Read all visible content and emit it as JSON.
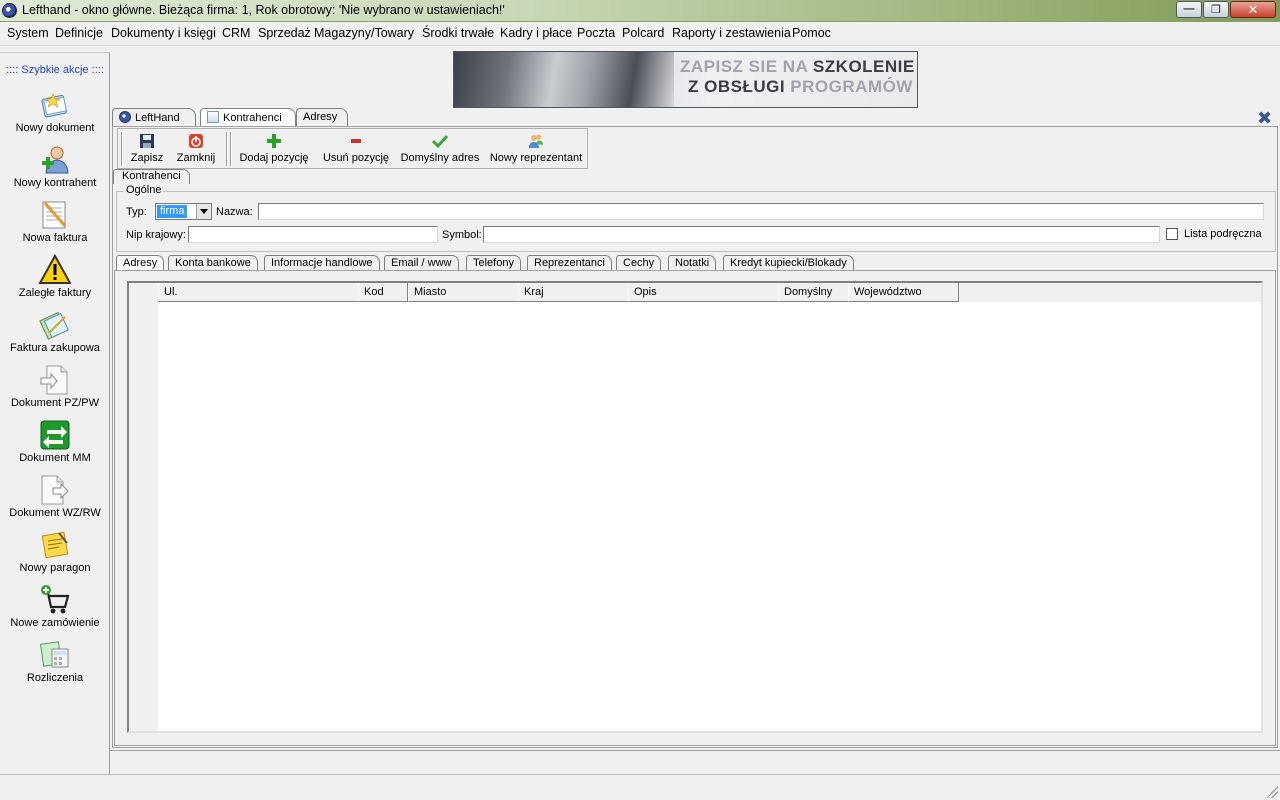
{
  "window": {
    "title": "Lefthand - okno główne. Bieżąca firma: 1, Rok obrotowy: 'Nie wybrano w ustawieniach!'"
  },
  "menu": [
    "System",
    "Definicje",
    "Dokumenty i księgi",
    "CRM",
    "Sprzedaż",
    "Magazyny/Towary",
    "Środki trwałe",
    "Kadry i płace",
    "Poczta",
    "Polcard",
    "Raporty i zestawienia",
    "Pomoc"
  ],
  "sidebar": {
    "title": ":::: Szybkie akcje ::::",
    "items": [
      {
        "label": "Nowy dokument",
        "icon": "new-document-icon"
      },
      {
        "label": "Nowy kontrahent",
        "icon": "new-contractor-icon"
      },
      {
        "label": "Nowa faktura",
        "icon": "new-invoice-icon"
      },
      {
        "label": "Zaległe faktury",
        "icon": "warning-icon"
      },
      {
        "label": "Faktura zakupowa",
        "icon": "purchase-invoice-icon"
      },
      {
        "label": "Dokument PZ/PW",
        "icon": "document-in-icon"
      },
      {
        "label": "Dokument MM",
        "icon": "transfer-icon"
      },
      {
        "label": "Dokument WZ/RW",
        "icon": "document-out-icon"
      },
      {
        "label": "Nowy paragon",
        "icon": "receipt-icon"
      },
      {
        "label": "Nowe zamówienie",
        "icon": "cart-icon"
      },
      {
        "label": "Rozliczenia",
        "icon": "settlements-icon"
      }
    ]
  },
  "banner": {
    "line1_a": "ZAPISZ SIE NA",
    "line1_b": "SZKOLENIE",
    "line2_a": "Z OBSŁUGI",
    "line2_b": "PROGRAMÓW"
  },
  "doc_tabs": [
    "LeftHand",
    "Kontrahenci",
    "Adresy"
  ],
  "toolbar": {
    "save": "Zapisz",
    "close": "Zamknij",
    "add": "Dodaj pozycję",
    "remove": "Usuń pozycję",
    "default_address": "Domyślny adres",
    "new_representative": "Nowy reprezentant"
  },
  "section_tab": "Kontrahenci",
  "general": {
    "legend": "Ogólne",
    "type_label": "Typ:",
    "type_value": "firma",
    "name_label": "Nazwa:",
    "name_value": "",
    "nip_label": "Nip krajowy:",
    "nip_value": "",
    "symbol_label": "Symbol:",
    "symbol_value": "",
    "quick_list_label": "Lista podręczna"
  },
  "sub_tabs": [
    "Adresy",
    "Konta bankowe",
    "Informacje handlowe",
    "Email / www",
    "Telefony",
    "Reprezentanci",
    "Cechy",
    "Notatki",
    "Kredyt kupiecki/Blokady"
  ],
  "grid": {
    "columns": [
      "Ul.",
      "Kod",
      "Miasto",
      "Kraj",
      "Opis",
      "Domyślny",
      "Województwo"
    ],
    "rows": []
  },
  "colors": {
    "accent_blue": "#2244cc",
    "selection": "#3399ff"
  }
}
